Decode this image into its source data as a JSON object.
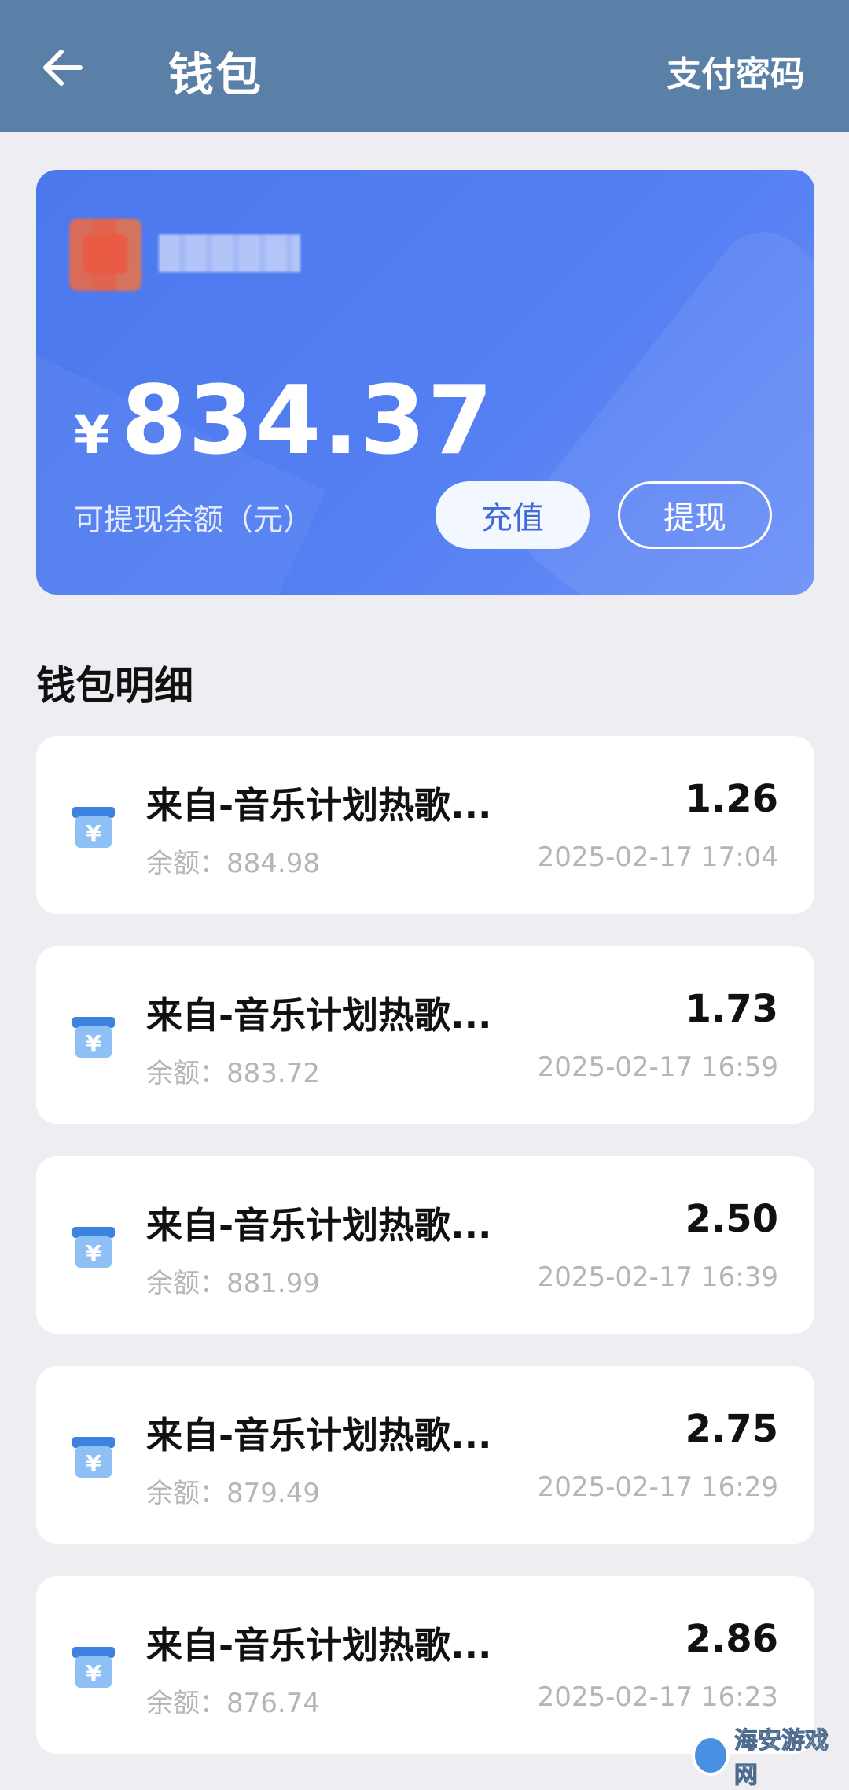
{
  "header": {
    "title": "钱包",
    "action_label": "支付密码",
    "background_color": "#5B80A8"
  },
  "card": {
    "currency_symbol": "¥",
    "balance": "834.37",
    "balance_label": "可提现余额（元）",
    "recharge_label": "充值",
    "withdraw_label": "提现",
    "accent_color": "#4C78EE"
  },
  "details": {
    "section_title": "钱包明细",
    "items": [
      {
        "title": "来自-音乐计划热歌...",
        "amount": "1.26",
        "balance": "余额：884.98",
        "time": "2025-02-17 17:04",
        "icon": "wallet-yen-icon"
      },
      {
        "title": "来自-音乐计划热歌...",
        "amount": "1.73",
        "balance": "余额：883.72",
        "time": "2025-02-17 16:59",
        "icon": "wallet-yen-icon"
      },
      {
        "title": "来自-音乐计划热歌...",
        "amount": "2.50",
        "balance": "余额：881.99",
        "time": "2025-02-17 16:39",
        "icon": "wallet-yen-icon"
      },
      {
        "title": "来自-音乐计划热歌...",
        "amount": "2.75",
        "balance": "余额：879.49",
        "time": "2025-02-17 16:29",
        "icon": "wallet-yen-icon"
      },
      {
        "title": "来自-音乐计划热歌...",
        "amount": "2.86",
        "balance": "余额：876.74",
        "time": "2025-02-17 16:23",
        "icon": "wallet-yen-icon"
      }
    ]
  },
  "watermark": {
    "text": "海安游戏网"
  }
}
